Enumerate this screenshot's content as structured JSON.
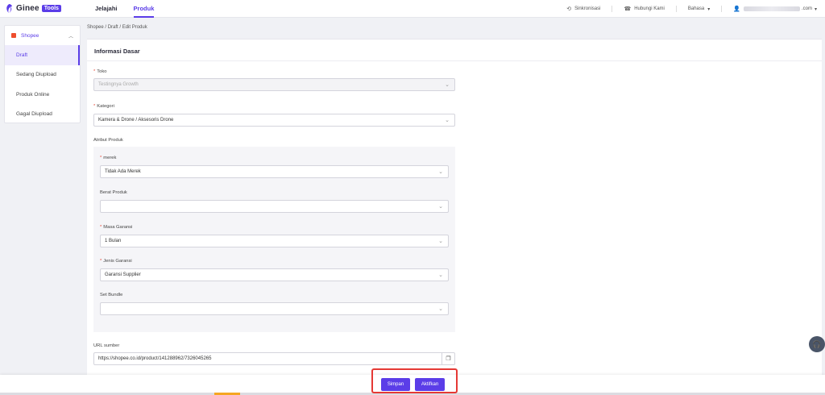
{
  "brand": {
    "name": "Ginee",
    "badge": "Tools"
  },
  "nav": {
    "tabs": [
      "Jelajahi",
      "Produk"
    ],
    "active": "Produk"
  },
  "top_right": {
    "sync": "Sinkronisasi",
    "contact": "Hubungi Kami",
    "language": "Bahasa",
    "account_suffix": ".com"
  },
  "sidebar": {
    "store": "Shopee",
    "items": [
      "Draft",
      "Sedang Diupload",
      "Produk Online",
      "Gagal Diupload"
    ],
    "active": "Draft"
  },
  "breadcrumb": "Shopee  /  Draft  /  Edit Produk",
  "form": {
    "section_title": "Informasi Dasar",
    "toko": {
      "label": "Toko",
      "value": "Testingnya Growth"
    },
    "kategori": {
      "label": "Kategori",
      "value": "Kamera & Drone / Aksesoris Drone"
    },
    "atribut_label": "Atribut Produk",
    "merek": {
      "label": "merek",
      "value": "Tidak Ada Merek"
    },
    "berat": {
      "label": "Berat Produk",
      "value": ""
    },
    "masa_garansi": {
      "label": "Masa Garansi",
      "value": "1 Bulan"
    },
    "jenis_garansi": {
      "label": "Jenis Garansi",
      "value": "Garansi Supplier"
    },
    "set_bundle": {
      "label": "Set Bundle",
      "value": ""
    },
    "url": {
      "label": "URL sumber",
      "value": "https://shopee.co.id/product/141288962/7326045265"
    }
  },
  "actions": {
    "save": "Simpan",
    "activate": "Aktifkan"
  },
  "colors": {
    "accent": "#5b3de8",
    "highlight": "#e53935",
    "shopee": "#ee4d2d"
  }
}
